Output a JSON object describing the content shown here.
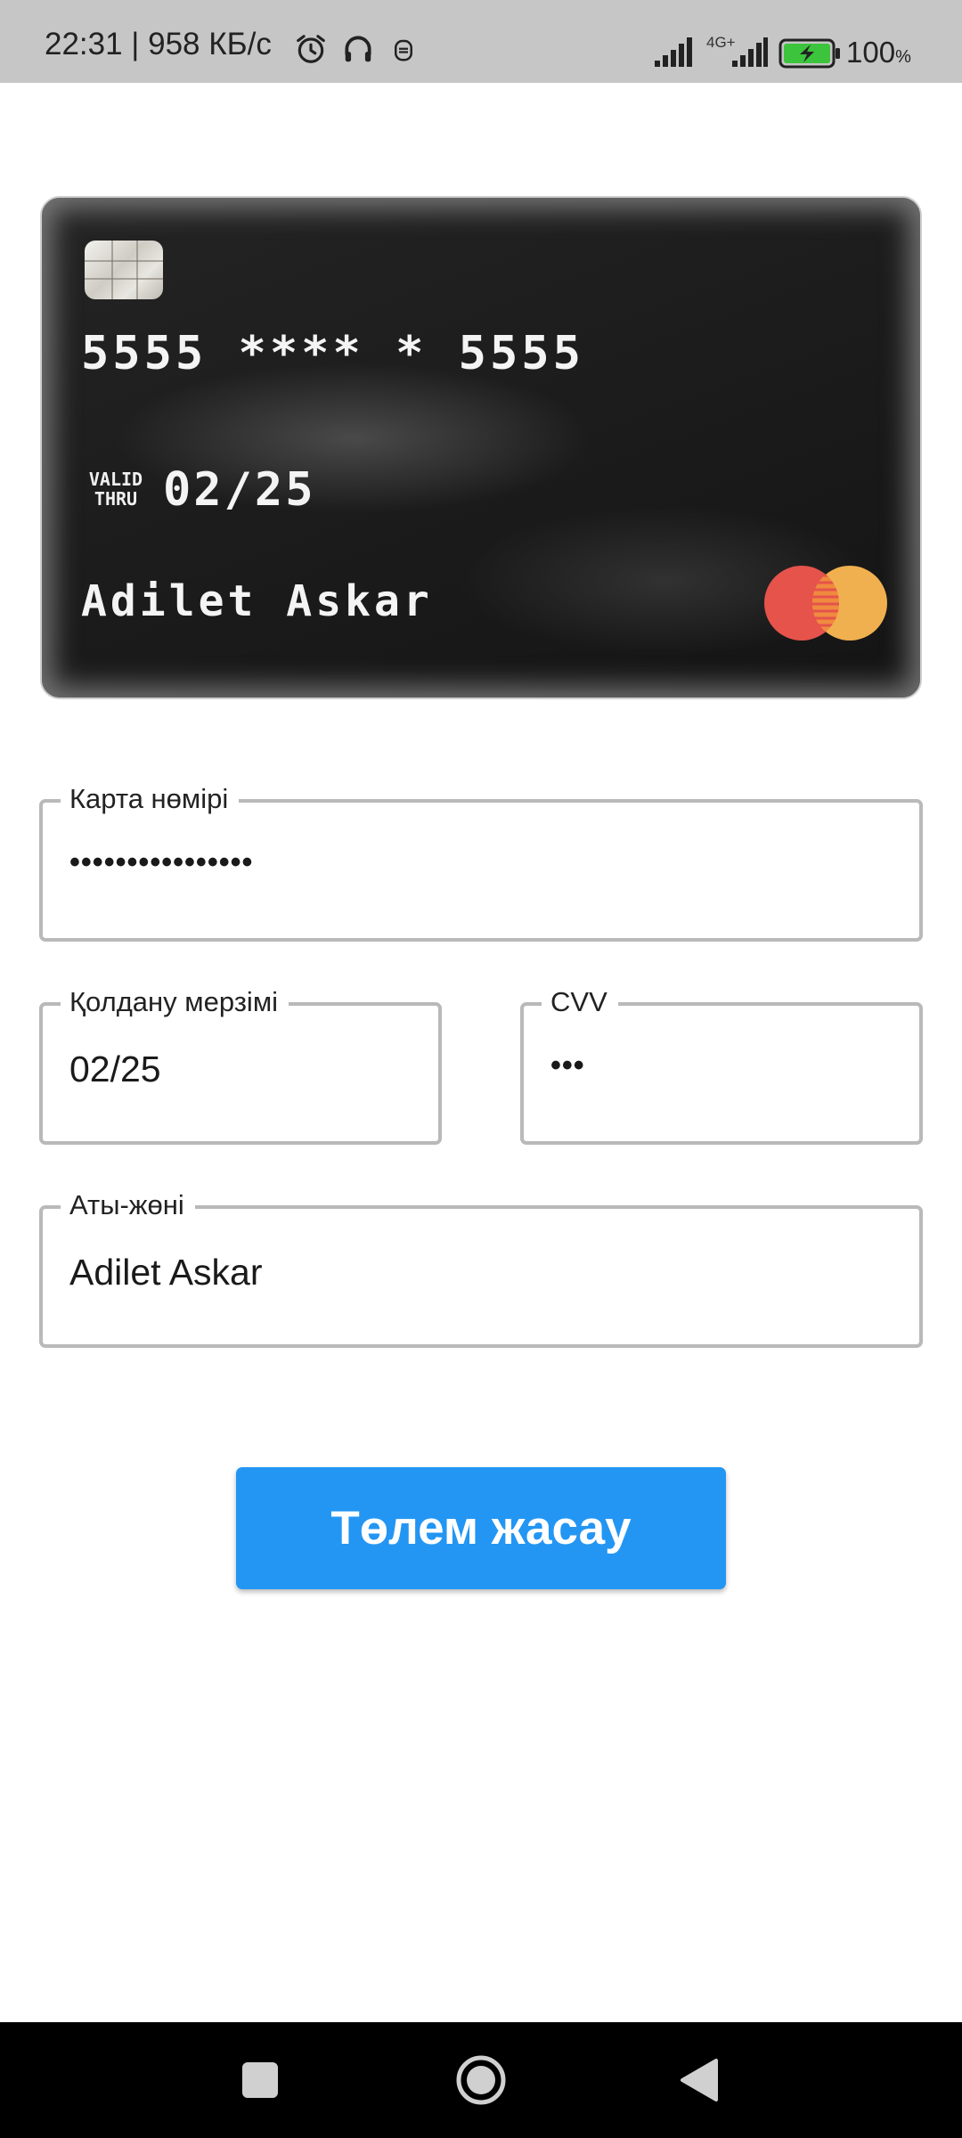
{
  "status_bar": {
    "time_text": "22:31 | 958 КБ/с",
    "network_type": "4G+",
    "battery_percent": "100",
    "battery_unit": "%",
    "icons": [
      "alarm-icon",
      "headphones-icon",
      "notification-icon",
      "signal-icon",
      "signal-4g-icon",
      "battery-charging-icon"
    ]
  },
  "card": {
    "number": "5555 **** * 5555",
    "valid_thru_label_1": "VALID",
    "valid_thru_label_2": "THRU",
    "expiry": "02/25",
    "holder": "Adilet Askar",
    "brand_icon": "mastercard-logo"
  },
  "form": {
    "card_number": {
      "label": "Карта нөмірі",
      "value": "••••••••••••••••"
    },
    "expiry": {
      "label": "Қолдану мерзімі",
      "value": "02/25"
    },
    "cvv": {
      "label": "CVV",
      "value": "•••"
    },
    "name": {
      "label": "Аты-жөні",
      "value": "Adilet Askar"
    }
  },
  "pay_button": {
    "label": "Төлем жасау",
    "color": "#2396f3"
  },
  "nav_bar": {
    "icons": [
      "recents-icon",
      "home-icon",
      "back-icon"
    ]
  }
}
